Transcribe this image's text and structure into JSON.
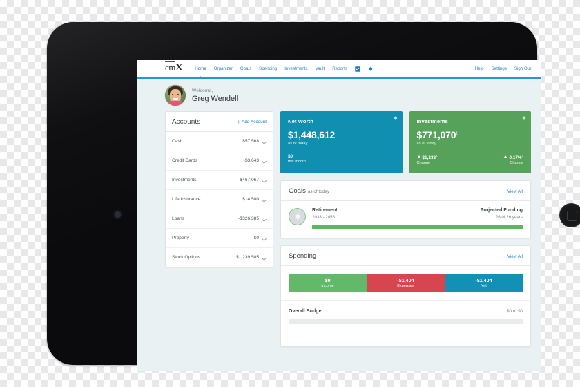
{
  "brand": {
    "logo_em": "em",
    "logo_x": "X",
    "accent": "#1c9ad6"
  },
  "nav": {
    "left_items": [
      {
        "label": "Home",
        "active": true
      },
      {
        "label": "Organizer",
        "active": false
      },
      {
        "label": "Goals",
        "active": false
      },
      {
        "label": "Spending",
        "active": false
      },
      {
        "label": "Investments",
        "active": false
      },
      {
        "label": "Vault",
        "active": false
      },
      {
        "label": "Reports",
        "active": false
      }
    ],
    "icons": [
      {
        "name": "tasks-checkbox-icon"
      },
      {
        "name": "bell-notification-icon"
      }
    ],
    "right_items": [
      {
        "label": "Help"
      },
      {
        "label": "Settings"
      },
      {
        "label": "Sign Out"
      }
    ]
  },
  "welcome": {
    "greeting": "Welcome,",
    "name": "Greg Wendell"
  },
  "accounts": {
    "title": "Accounts",
    "add_label": "Add Account",
    "add_plus": "+",
    "rows": [
      {
        "name": "Cash",
        "value": "$57,568"
      },
      {
        "name": "Credit Cards",
        "value": "-$3,643"
      },
      {
        "name": "Investments",
        "value": "$467,067"
      },
      {
        "name": "Life Insurance",
        "value": "$14,500"
      },
      {
        "name": "Loans",
        "value": "-$326,385"
      },
      {
        "name": "Property",
        "value": "$0"
      },
      {
        "name": "Stock Options",
        "value": "$1,239,505"
      }
    ]
  },
  "net_worth": {
    "title": "Net Worth",
    "amount": "$1,448,612",
    "as_of": "as of today",
    "change_value": "$0",
    "change_label": "this month",
    "color": "#118fb0"
  },
  "investments": {
    "title": "Investments",
    "amount": "$771,070",
    "amount_sup": "1",
    "as_of": "as of today",
    "change_value": "$1,338",
    "change_value_sup": "2",
    "change_label": "Change",
    "percent_value": "0.17%",
    "percent_value_sup": "3",
    "percent_label": "Change",
    "color": "#56a25b"
  },
  "goals": {
    "title": "Goals",
    "subtitle": "as of today",
    "view_all": "View All",
    "item": {
      "name": "Retirement",
      "years": "2033 - 2058",
      "funding_label": "Projected Funding",
      "funding_value": "26 of 26 years",
      "progress_percent": 100,
      "bar_color": "#5cb85c"
    }
  },
  "spending": {
    "title": "Spending",
    "view_all": "View All",
    "segments": [
      {
        "value": "$0",
        "label": "Income",
        "color": "#62b96a"
      },
      {
        "value": "-$1,404",
        "label": "Expenses",
        "color": "#d6464f"
      },
      {
        "value": "-$1,404",
        "label": "Net",
        "color": "#1290b6"
      }
    ],
    "budget": {
      "name": "Overall Budget",
      "value": "$0 of $0",
      "progress_percent": 0
    }
  }
}
